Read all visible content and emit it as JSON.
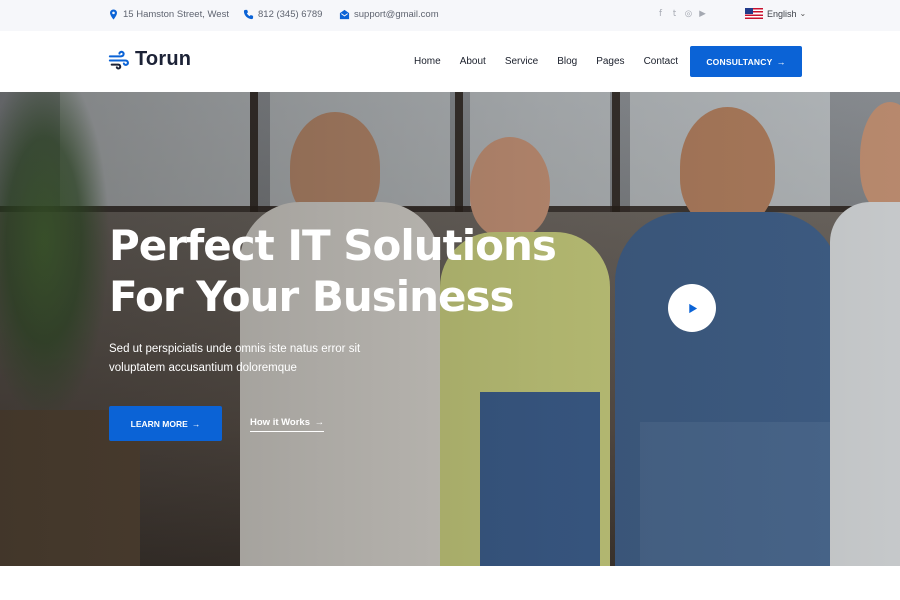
{
  "topbar": {
    "address": "15 Hamston Street, West",
    "phone": "812 (345) 6789",
    "email": "support@gmail.com",
    "social_icons": [
      "facebook-icon",
      "twitter-icon",
      "instagram-icon",
      "youtube-icon"
    ],
    "social_glyphs": [
      "f",
      "t",
      "◎",
      "▶"
    ],
    "language": "English"
  },
  "header": {
    "logo": "Torun",
    "nav": [
      "Home",
      "About",
      "Service",
      "Blog",
      "Pages",
      "Contact"
    ],
    "cta_label": "CONSULTANCY",
    "cta_arrow": "→"
  },
  "hero": {
    "title_line1": "Perfect IT Solutions",
    "title_line2": "For Your Business",
    "subtitle_line1": "Sed ut perspiciatis unde omnis iste natus error sit",
    "subtitle_line2": "voluptatem accusantium doloremque",
    "learn_more": "LEARN MORE",
    "how_it_works": "How it Works",
    "arrow": "→"
  },
  "colors": {
    "accent": "#0b63d6",
    "topbar_bg": "#f6f7fa",
    "icon_blue": "#0b63d6"
  }
}
